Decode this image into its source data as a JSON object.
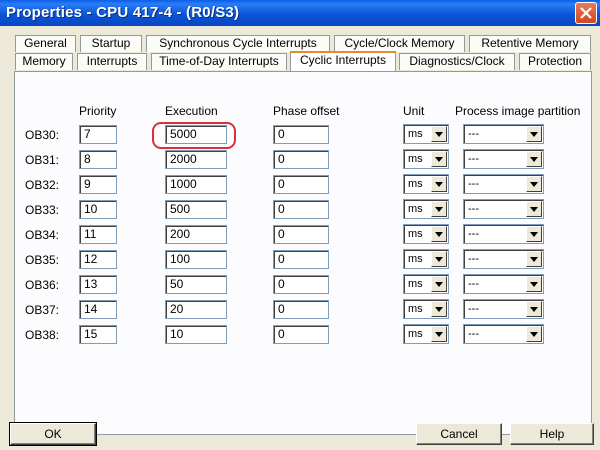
{
  "window": {
    "title": "Properties - CPU 417-4 - (R0/S3)"
  },
  "tabs": {
    "row1": [
      "General",
      "Startup",
      "Synchronous Cycle Interrupts",
      "Cycle/Clock Memory",
      "Retentive Memory"
    ],
    "row2": [
      "Memory",
      "Interrupts",
      "Time-of-Day Interrupts",
      "Cyclic Interrupts",
      "Diagnostics/Clock",
      "Protection"
    ],
    "active": "Cyclic Interrupts"
  },
  "headers": {
    "priority": "Priority",
    "execution": "Execution",
    "phase_offset": "Phase offset",
    "unit": "Unit",
    "process_image_partition": "Process image partition"
  },
  "rows": [
    {
      "ob": "OB30:",
      "priority": "7",
      "execution": "5000",
      "phase_offset": "0",
      "unit": "ms",
      "partition": "---"
    },
    {
      "ob": "OB31:",
      "priority": "8",
      "execution": "2000",
      "phase_offset": "0",
      "unit": "ms",
      "partition": "---"
    },
    {
      "ob": "OB32:",
      "priority": "9",
      "execution": "1000",
      "phase_offset": "0",
      "unit": "ms",
      "partition": "---"
    },
    {
      "ob": "OB33:",
      "priority": "10",
      "execution": "500",
      "phase_offset": "0",
      "unit": "ms",
      "partition": "---"
    },
    {
      "ob": "OB34:",
      "priority": "11",
      "execution": "200",
      "phase_offset": "0",
      "unit": "ms",
      "partition": "---"
    },
    {
      "ob": "OB35:",
      "priority": "12",
      "execution": "100",
      "phase_offset": "0",
      "unit": "ms",
      "partition": "---"
    },
    {
      "ob": "OB36:",
      "priority": "13",
      "execution": "50",
      "phase_offset": "0",
      "unit": "ms",
      "partition": "---"
    },
    {
      "ob": "OB37:",
      "priority": "14",
      "execution": "20",
      "phase_offset": "0",
      "unit": "ms",
      "partition": "---"
    },
    {
      "ob": "OB38:",
      "priority": "15",
      "execution": "10",
      "phase_offset": "0",
      "unit": "ms",
      "partition": "---"
    }
  ],
  "buttons": {
    "ok": "OK",
    "cancel": "Cancel",
    "help": "Help"
  },
  "colors": {
    "titlebar": "#0b55d8",
    "highlight": "#d9303a",
    "active_tab_accent": "#e68b2c"
  },
  "icons": {
    "close": "close-icon",
    "dropdown": "chevron-down-icon"
  }
}
